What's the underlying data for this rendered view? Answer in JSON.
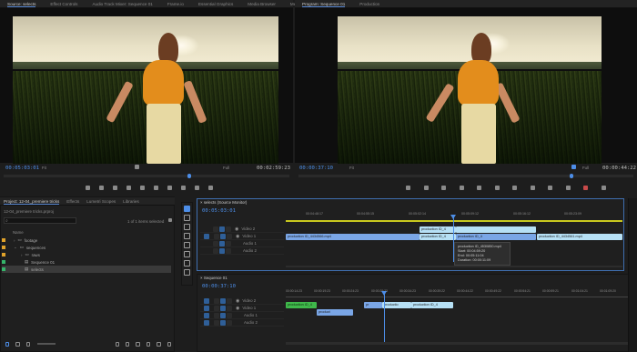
{
  "source_tabs": [
    "Source: selects",
    "Effect Controls",
    "Audio Track Mixer: Sequence 01",
    "Frame.io",
    "Essential Graphics",
    "Media Browser",
    "Metadata"
  ],
  "program_tabs": [
    "Program: Sequence 01",
    "Production"
  ],
  "source": {
    "timecode": "00:05:03:01",
    "fit": "Fit",
    "full": "Full",
    "duration": "00:02:59:23"
  },
  "program": {
    "timecode": "00:00:37:10",
    "fit": "Fit",
    "full": "Full",
    "duration": "00:00:44:22"
  },
  "project_tabs": [
    "Project: 12-04_premiere tricks",
    "Effects",
    "Lumetri Scopes",
    "Libraries"
  ],
  "project": {
    "path": "12-04_premiere tricks.prproj",
    "selected": "1 of 1 items selected",
    "name_header": "Name",
    "items": [
      {
        "label": "footage",
        "color": "#e0a22a"
      },
      {
        "label": "sequences",
        "color": "#e0a22a"
      },
      {
        "label": "raws",
        "color": "#e0a22a"
      },
      {
        "label": "Sequence 01",
        "color": "#35b56a"
      },
      {
        "label": "selects",
        "color": "#35b56a"
      }
    ]
  },
  "source_seq": {
    "tab": "selects (Source Monitor)",
    "timecode": "00:05:03:01",
    "ruler": [
      "00:04:48:17",
      "00:04:55:15",
      "00:05:02:14",
      "00:05:09:12",
      "00:05:16:12",
      "00:05:23:09"
    ],
    "tracks": [
      "Video 2",
      "Video 1",
      "Audio 1",
      "Audio 2"
    ],
    "clips": [
      "production ID_4",
      "production ID_4434566.mp4",
      "production ID_4",
      "production ID_4",
      "production ID_4434561.mp4"
    ],
    "tooltip": [
      "production ID_4530850.mp4",
      "Start: 00:04:59:20",
      "End: 00:05:11:04",
      "Duration: 00:00:11:09"
    ]
  },
  "sequence": {
    "tab": "Sequence 01",
    "timecode": "00:00:37:10",
    "ruler": [
      "00:00:14:23",
      "00:00:19:23",
      "00:00:24:23",
      "00:00:29:23",
      "00:00:34:23",
      "00:00:39:22",
      "00:00:44:22",
      "00:00:49:22",
      "00:00:54:21",
      "00:00:59:21",
      "00:01:04:21",
      "00:01:09:20"
    ],
    "tracks": [
      "Video 2",
      "Video 1",
      "Audio 1",
      "Audio 2"
    ],
    "clips": [
      "production ID_4",
      "product",
      "pr",
      "productio",
      "production ID_4"
    ]
  },
  "icons": [
    "select-tool",
    "track-select-tool",
    "ripple-tool",
    "razor-tool",
    "slip-tool",
    "pen-tool",
    "hand-tool",
    "type-tool"
  ],
  "colors": {
    "accent": "#4d8ee8",
    "clip_blue": "#7aa6e6",
    "clip_lightblue": "#b6e0f5",
    "clip_green": "#3fb94b"
  }
}
